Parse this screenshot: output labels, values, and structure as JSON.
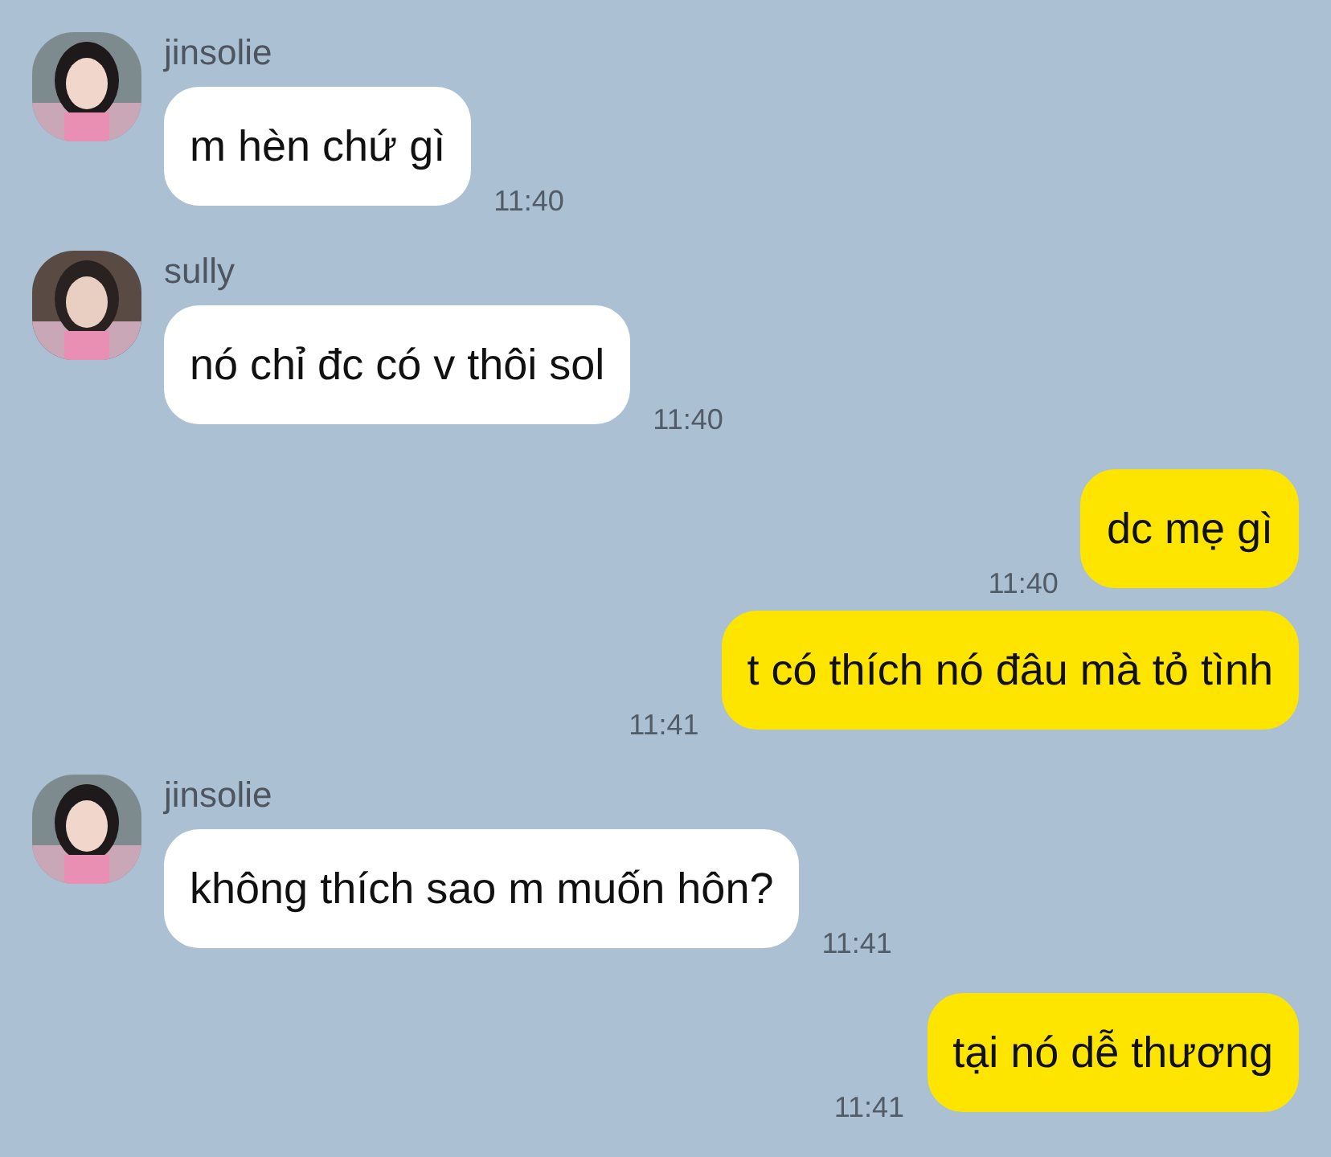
{
  "messages": [
    {
      "kind": "incoming",
      "sender": "jinsolie",
      "text": "m hèn chứ gì",
      "time": "11:40"
    },
    {
      "kind": "incoming",
      "sender": "sully",
      "text": "nó chỉ đc có v thôi sol",
      "time": "11:40"
    },
    {
      "kind": "outgoing",
      "text": "dc mẹ gì",
      "time": "11:40"
    },
    {
      "kind": "outgoing",
      "text": "t có thích nó đâu mà tỏ tình",
      "time": "11:41"
    },
    {
      "kind": "incoming",
      "sender": "jinsolie",
      "text": "không thích sao m muốn hôn?",
      "time": "11:41"
    },
    {
      "kind": "outgoing",
      "text": "tại nó dễ thương",
      "time": "11:41"
    }
  ]
}
